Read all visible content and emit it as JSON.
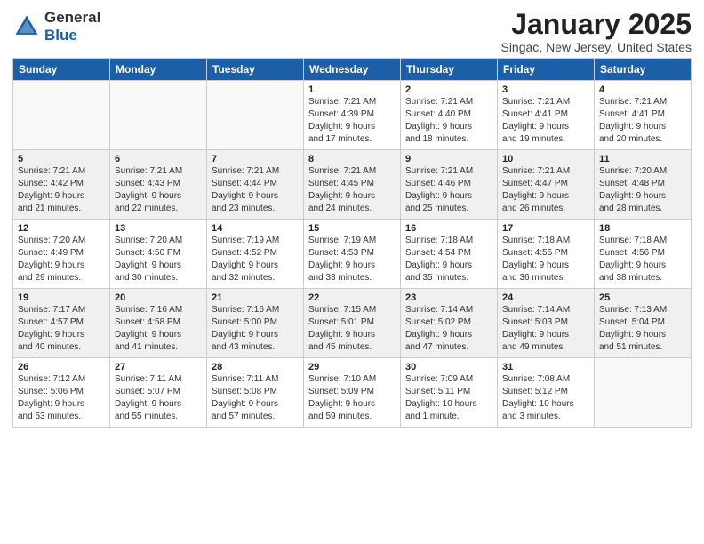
{
  "logo": {
    "general": "General",
    "blue": "Blue"
  },
  "header": {
    "title": "January 2025",
    "subtitle": "Singac, New Jersey, United States"
  },
  "weekdays": [
    "Sunday",
    "Monday",
    "Tuesday",
    "Wednesday",
    "Thursday",
    "Friday",
    "Saturday"
  ],
  "weeks": [
    [
      {
        "day": "",
        "info": ""
      },
      {
        "day": "",
        "info": ""
      },
      {
        "day": "",
        "info": ""
      },
      {
        "day": "1",
        "info": "Sunrise: 7:21 AM\nSunset: 4:39 PM\nDaylight: 9 hours\nand 17 minutes."
      },
      {
        "day": "2",
        "info": "Sunrise: 7:21 AM\nSunset: 4:40 PM\nDaylight: 9 hours\nand 18 minutes."
      },
      {
        "day": "3",
        "info": "Sunrise: 7:21 AM\nSunset: 4:41 PM\nDaylight: 9 hours\nand 19 minutes."
      },
      {
        "day": "4",
        "info": "Sunrise: 7:21 AM\nSunset: 4:41 PM\nDaylight: 9 hours\nand 20 minutes."
      }
    ],
    [
      {
        "day": "5",
        "info": "Sunrise: 7:21 AM\nSunset: 4:42 PM\nDaylight: 9 hours\nand 21 minutes."
      },
      {
        "day": "6",
        "info": "Sunrise: 7:21 AM\nSunset: 4:43 PM\nDaylight: 9 hours\nand 22 minutes."
      },
      {
        "day": "7",
        "info": "Sunrise: 7:21 AM\nSunset: 4:44 PM\nDaylight: 9 hours\nand 23 minutes."
      },
      {
        "day": "8",
        "info": "Sunrise: 7:21 AM\nSunset: 4:45 PM\nDaylight: 9 hours\nand 24 minutes."
      },
      {
        "day": "9",
        "info": "Sunrise: 7:21 AM\nSunset: 4:46 PM\nDaylight: 9 hours\nand 25 minutes."
      },
      {
        "day": "10",
        "info": "Sunrise: 7:21 AM\nSunset: 4:47 PM\nDaylight: 9 hours\nand 26 minutes."
      },
      {
        "day": "11",
        "info": "Sunrise: 7:20 AM\nSunset: 4:48 PM\nDaylight: 9 hours\nand 28 minutes."
      }
    ],
    [
      {
        "day": "12",
        "info": "Sunrise: 7:20 AM\nSunset: 4:49 PM\nDaylight: 9 hours\nand 29 minutes."
      },
      {
        "day": "13",
        "info": "Sunrise: 7:20 AM\nSunset: 4:50 PM\nDaylight: 9 hours\nand 30 minutes."
      },
      {
        "day": "14",
        "info": "Sunrise: 7:19 AM\nSunset: 4:52 PM\nDaylight: 9 hours\nand 32 minutes."
      },
      {
        "day": "15",
        "info": "Sunrise: 7:19 AM\nSunset: 4:53 PM\nDaylight: 9 hours\nand 33 minutes."
      },
      {
        "day": "16",
        "info": "Sunrise: 7:18 AM\nSunset: 4:54 PM\nDaylight: 9 hours\nand 35 minutes."
      },
      {
        "day": "17",
        "info": "Sunrise: 7:18 AM\nSunset: 4:55 PM\nDaylight: 9 hours\nand 36 minutes."
      },
      {
        "day": "18",
        "info": "Sunrise: 7:18 AM\nSunset: 4:56 PM\nDaylight: 9 hours\nand 38 minutes."
      }
    ],
    [
      {
        "day": "19",
        "info": "Sunrise: 7:17 AM\nSunset: 4:57 PM\nDaylight: 9 hours\nand 40 minutes."
      },
      {
        "day": "20",
        "info": "Sunrise: 7:16 AM\nSunset: 4:58 PM\nDaylight: 9 hours\nand 41 minutes."
      },
      {
        "day": "21",
        "info": "Sunrise: 7:16 AM\nSunset: 5:00 PM\nDaylight: 9 hours\nand 43 minutes."
      },
      {
        "day": "22",
        "info": "Sunrise: 7:15 AM\nSunset: 5:01 PM\nDaylight: 9 hours\nand 45 minutes."
      },
      {
        "day": "23",
        "info": "Sunrise: 7:14 AM\nSunset: 5:02 PM\nDaylight: 9 hours\nand 47 minutes."
      },
      {
        "day": "24",
        "info": "Sunrise: 7:14 AM\nSunset: 5:03 PM\nDaylight: 9 hours\nand 49 minutes."
      },
      {
        "day": "25",
        "info": "Sunrise: 7:13 AM\nSunset: 5:04 PM\nDaylight: 9 hours\nand 51 minutes."
      }
    ],
    [
      {
        "day": "26",
        "info": "Sunrise: 7:12 AM\nSunset: 5:06 PM\nDaylight: 9 hours\nand 53 minutes."
      },
      {
        "day": "27",
        "info": "Sunrise: 7:11 AM\nSunset: 5:07 PM\nDaylight: 9 hours\nand 55 minutes."
      },
      {
        "day": "28",
        "info": "Sunrise: 7:11 AM\nSunset: 5:08 PM\nDaylight: 9 hours\nand 57 minutes."
      },
      {
        "day": "29",
        "info": "Sunrise: 7:10 AM\nSunset: 5:09 PM\nDaylight: 9 hours\nand 59 minutes."
      },
      {
        "day": "30",
        "info": "Sunrise: 7:09 AM\nSunset: 5:11 PM\nDaylight: 10 hours\nand 1 minute."
      },
      {
        "day": "31",
        "info": "Sunrise: 7:08 AM\nSunset: 5:12 PM\nDaylight: 10 hours\nand 3 minutes."
      },
      {
        "day": "",
        "info": ""
      }
    ]
  ]
}
